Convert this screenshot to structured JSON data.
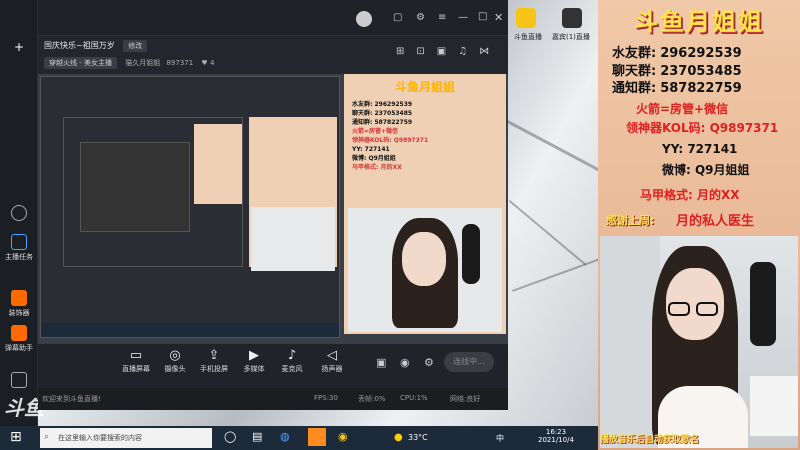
{
  "window": {
    "title": "国庆快乐~祖国万岁",
    "tag": "修改"
  },
  "info": {
    "category": "穿越火线 - 美女主播",
    "owner": "猫久月姐姐",
    "room_id": "897371",
    "likes": "4"
  },
  "controls": [
    {
      "label": "直播屏幕",
      "icon": "screen-icon"
    },
    {
      "label": "摄像头",
      "icon": "camera-icon"
    },
    {
      "label": "手机投屏",
      "icon": "phone-cast-icon"
    },
    {
      "label": "多媒体",
      "icon": "media-icon"
    },
    {
      "label": "麦克风",
      "icon": "mic-icon"
    },
    {
      "label": "扬声器",
      "icon": "speaker-icon"
    }
  ],
  "golive": "连线中...",
  "status": {
    "left": "欢迎来到斗鱼直播!",
    "fps": "FPS:30",
    "drop": "丢帧:0%",
    "cpu": "CPU:1%",
    "network": "网络:良好"
  },
  "left_items": [
    {
      "label": "主播任务"
    },
    {
      "label": "装饰器"
    },
    {
      "label": "弹幕助手"
    }
  ],
  "taskbar": {
    "search": "在这里输入你要搜索的内容",
    "temp": "33°C",
    "lang": "中",
    "time": "16:23",
    "date": "2021/10/4"
  },
  "overlay_small": {
    "app1": "斗鱼直播",
    "app2": "嘉宾(1)直播"
  },
  "panel": {
    "title": "斗鱼月姐姐",
    "lines": [
      {
        "label": "水友群:",
        "value": "296292539"
      },
      {
        "label": "聊天群:",
        "value": "237053485"
      },
      {
        "label": "通知群:",
        "value": "587822759"
      }
    ],
    "rocket": "火箭=房管+微信",
    "kol": "领神器KOL码: Q9897371",
    "yy": "YY: 727141",
    "weibo": "微博: Q9月姐姐",
    "format": "马甲格式: 月的XX",
    "thanks_label": "感谢上周:",
    "thanks_value": "月的私人医生",
    "marquee": "播放音乐后自动获取歌名"
  },
  "watermark": "斗鱼",
  "colors": {
    "accent": "#ffe44b",
    "red": "#e02020",
    "orange": "#ff6a00"
  }
}
